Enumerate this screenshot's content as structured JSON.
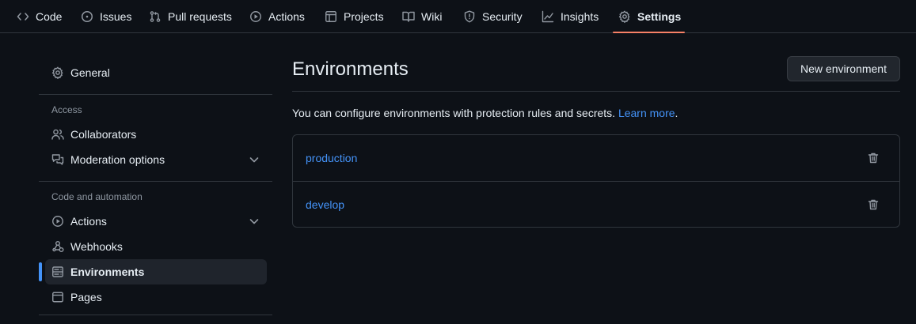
{
  "repo_nav": {
    "tabs": [
      {
        "label": "Code",
        "icon": "code-icon"
      },
      {
        "label": "Issues",
        "icon": "issue-opened-icon"
      },
      {
        "label": "Pull requests",
        "icon": "git-pull-request-icon"
      },
      {
        "label": "Actions",
        "icon": "play-icon"
      },
      {
        "label": "Projects",
        "icon": "table-icon"
      },
      {
        "label": "Wiki",
        "icon": "book-icon"
      },
      {
        "label": "Security",
        "icon": "shield-icon"
      },
      {
        "label": "Insights",
        "icon": "graph-icon"
      },
      {
        "label": "Settings",
        "icon": "gear-icon",
        "selected": true
      }
    ]
  },
  "sidebar": {
    "general": {
      "label": "General",
      "icon": "gear-icon"
    },
    "access_heading": "Access",
    "access_items": [
      {
        "label": "Collaborators",
        "icon": "people-icon"
      },
      {
        "label": "Moderation options",
        "icon": "comment-discussion-icon",
        "expandable": true
      }
    ],
    "automation_heading": "Code and automation",
    "automation_items": [
      {
        "label": "Actions",
        "icon": "play-icon",
        "expandable": true
      },
      {
        "label": "Webhooks",
        "icon": "webhook-icon"
      },
      {
        "label": "Environments",
        "icon": "server-icon",
        "selected": true
      },
      {
        "label": "Pages",
        "icon": "browser-icon"
      }
    ]
  },
  "main": {
    "title": "Environments",
    "new_button": "New environment",
    "description": "You can configure environments with protection rules and secrets.",
    "learn_more": "Learn more",
    "description_end": ".",
    "environments": [
      {
        "name": "production"
      },
      {
        "name": "develop"
      }
    ]
  },
  "colors": {
    "background": "#0d1117",
    "border": "#30363d",
    "link": "#4493f8",
    "tab_underline": "#f78166",
    "active_bar": "#4493f8"
  }
}
